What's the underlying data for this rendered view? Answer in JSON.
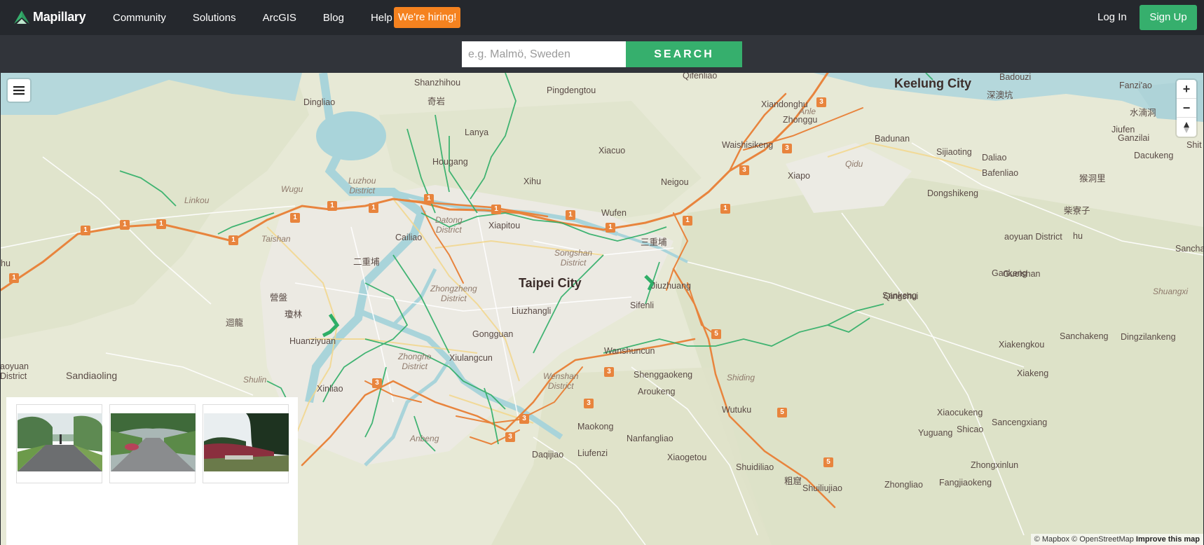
{
  "header": {
    "logo_text": "Mapillary",
    "nav": [
      "Community",
      "Solutions",
      "ArcGIS",
      "Blog",
      "Help"
    ],
    "hiring": "We're hiring!",
    "login": "Log In",
    "signup": "Sign Up"
  },
  "search": {
    "placeholder": "e.g. Malmö, Sweden",
    "button": "SEARCH"
  },
  "map": {
    "zoom_in": "+",
    "zoom_out": "−",
    "attribution": {
      "mapbox": "© Mapbox",
      "osm": "© OpenStreetMap",
      "improve": "Improve this map"
    },
    "cities": {
      "taipei": "Taipei City",
      "keelung": "Keelung City"
    },
    "districts": [
      "Luzhou District",
      "Wugu",
      "Linkou",
      "Taishan",
      "Datong District",
      "Zhongzheng District",
      "Songshan District",
      "Zhonghe District",
      "Wenshan District",
      "Anle",
      "Qidu",
      "Shuangxi",
      "Shiding",
      "Anbeng",
      "Shulin"
    ],
    "places": [
      "Shanzhihou",
      "Pingdengtou",
      "Qifenliao",
      "Dingliao",
      "Lanya",
      "Hougang",
      "Xiacuo",
      "Xihu",
      "Neigou",
      "Xiandonghu",
      "Zhonggu",
      "Waishisikeng",
      "Badunan",
      "Sijiaoting",
      "Daliao",
      "Bafenliao",
      "Xiapo",
      "Dongshikeng",
      "Keelung City",
      "Badouzi",
      "Fanzi'ao",
      "Jiufen",
      "Ganzilai",
      "Dacukeng",
      "Wufen",
      "Xiapitou",
      "Cailiao",
      "Jiuzhuang",
      "Sifenli",
      "Liuzhangli",
      "Gongguan",
      "Xiulangcun",
      "Huanziyuan",
      "Wanshuncun",
      "Shenggaokeng",
      "Aroukeng",
      "Maokong",
      "Nanfangliao",
      "Xiaogetou",
      "Daqijiao",
      "Liufenzi",
      "Wutuku",
      "Shuidiliao",
      "Shuiliujiao",
      "Zhongliao",
      "Fangjiaokeng",
      "Zhongxinlun",
      "Sancengxiang",
      "Yuguang",
      "Shicao",
      "Xiaocukeng",
      "Xiakeng",
      "Xiakengkou",
      "Sanchakeng",
      "Dingzilankeng",
      "Sankeng",
      "Gankeng",
      "Xinliao",
      "Sandiaoling",
      "Qingshui",
      "Gueishan",
      "aoyuan District",
      "hu",
      "Shit",
      "Sancha"
    ],
    "cjk": [
      "奇岩",
      "二重埔",
      "三重埔",
      "營盤",
      "瓊林",
      "迴龍",
      "深澳坑",
      "水湳洞",
      "猴洞里",
      "柴寮子",
      "粗窟"
    ],
    "shields": [
      "1",
      "3",
      "5"
    ]
  },
  "thumbnails": [
    {
      "alt": "street-level-photo-1"
    },
    {
      "alt": "street-level-photo-2"
    },
    {
      "alt": "street-level-photo-3"
    }
  ]
}
